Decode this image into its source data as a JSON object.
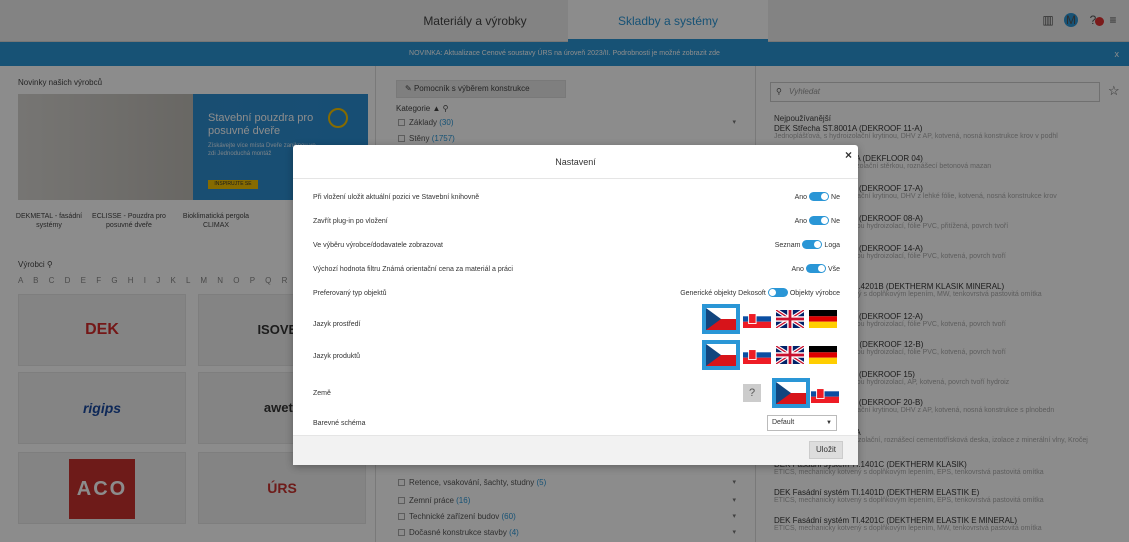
{
  "topbar": {
    "tab_materials": "Materiály a výrobky",
    "tab_compositions": "Skladby a systémy",
    "user_initial": "M"
  },
  "newsbar": {
    "text": "NOVINKA: Aktualizace Cenové soustavy ÚRS na úroveň 2023/II. Podrobnosti je možné zobrazit zde",
    "close": "x"
  },
  "left": {
    "news_title": "Novinky našich výrobců",
    "banner": {
      "title": "Stavební pouzdra pro posuvné dveře",
      "subtitle": "Získávejte více místa Dveře zaniknou ve zdi Jednoduchá montáž",
      "button": "INSPIRUJTE SE"
    },
    "captions": [
      "DEKMETAL - fasádní systémy",
      "ECLISSE - Pouzdra pro posuvné dveře",
      "Bioklimatická pergola CLIMAX"
    ],
    "manufacturers_title": "Výrobci",
    "alphabet": "A B C D E F G H I J K L M N O P Q R S T",
    "logos": [
      "DEK",
      "ISOVER",
      "rigips",
      "aweta",
      "ACO",
      "ÚRS"
    ]
  },
  "mid": {
    "helper_button": "Pomocník s výběrem konstrukce",
    "categories_title": "Kategorie ▲",
    "items": [
      {
        "label": "Základy",
        "count": "(30)"
      },
      {
        "label": "Stěny",
        "count": "(1757)"
      },
      {
        "label": "Retence, vsakování, šachty, studny",
        "count": "(5)"
      },
      {
        "label": "Zemní práce",
        "count": "(16)"
      },
      {
        "label": "Technické zařízení budov",
        "count": "(60)"
      },
      {
        "label": "Dočasné konstrukce stavby",
        "count": "(4)"
      }
    ]
  },
  "right": {
    "search_placeholder": "Vyhledat",
    "most_used": "Nejpoužívanější",
    "items": [
      {
        "title": "DEK Střecha ST.8001A (DEKROOF 11-A)",
        "desc": "Jednoplášťová, s hydroizolační krytinou, DHV z AP, kotvená, nosná konstrukce krov v podhl"
      },
      {
        "title": "DEK Podlaha PD.1001A (DEKFLOOR 04)",
        "desc": "Podlaha plovoucí, s hydroizolační stěrkou, roznášecí betonová mazan"
      },
      {
        "title": "DEK Střecha ST.2001A (DEKROOF 17-A)",
        "desc": "Jednoplášťová, s hydroizolační krytinou, DHV z lehké fólie, kotvená, nosná konstrukce krov"
      },
      {
        "title": "DEK Střecha ST.2001A (DEKROOF 08-A)",
        "desc": "Jednoplášťová, s povlakovou hydroizolací, fólie PVC, přitížená, povrch tvoří"
      },
      {
        "title": "DEK Střecha ST.2001A (DEKROOF 14-A)",
        "desc": "Jednoplášťová, s povlakovou hydroizolací, fólie PVC, kotvená, povrch tvoří"
      },
      {
        "title": "DEK Fasádní systém TI.4201B (DEKTHERM KLASIK MINERAL)",
        "desc": "ETICS, mechanicky kotvený s doplňkovým lepením, MW, tenkovrstvá pastovitá omítka"
      },
      {
        "title": "DEK Střecha ST.2001A (DEKROOF 12-A)",
        "desc": "Jednoplášťová, s povlakovou hydroizolací, fólie PVC, kotvená, povrch tvoří"
      },
      {
        "title": "DEK Střecha ST.2001B (DEKROOF 12-B)",
        "desc": "Jednoplášťová, s povlakovou hydroizolací, fólie PVC, kotvená, povrch tvoří"
      },
      {
        "title": "DEK Střecha ST.2001A (DEKROOF 15)",
        "desc": "Jednoplášťová, s povlakovou hydroizolací, AP, kotvená, povrch tvoří hydroiz"
      },
      {
        "title": "DEK Střecha ST.8001F (DEKROOF 20-B)",
        "desc": "Jednoplášťová, s hydroizolační krytinou, DHV z AP, kotvená, nosná konstrukce s plnobedn"
      },
      {
        "title": "DEK Podlaha PD.1001A",
        "desc": "Podlaha plovoucí, tepelně izolační, roznášecí cementotřísková deska, izolace z minerální vlny, Kročej"
      },
      {
        "title": "DEK Fasádní systém TI.1401C (DEKTHERM KLASIK)",
        "desc": "ETICS, mechanicky kotvený s doplňkovým lepením, EPS, tenkovrstvá pastovitá omítka"
      },
      {
        "title": "DEK Fasádní systém TI.1401D (DEKTHERM ELASTIK E)",
        "desc": "ETICS, mechanicky kotvený s doplňkovým lepením, EPS, tenkovrstvá pastovitá omítka"
      },
      {
        "title": "DEK Fasádní systém TI.4201C (DEKTHERM ELASTIK E MINERAL)",
        "desc": "ETICS, mechanicky kotvený s doplňkovým lepením, MW, tenkovrstvá pastovitá omítka"
      }
    ]
  },
  "modal": {
    "title": "Nastavení",
    "close": "×",
    "rows": [
      {
        "label": "Při vložení uložit aktuální pozici ve Stavební knihovně",
        "left": "Ano",
        "right": "Ne"
      },
      {
        "label": "Zavřít plug-in po vložení",
        "left": "Ano",
        "right": "Ne"
      },
      {
        "label": "Ve výběru výrobce/dodavatele zobrazovat",
        "left": "Seznam",
        "right": "Loga"
      },
      {
        "label": "Výchozí hodnota filtru Známá orientační cena za materiál a práci",
        "left": "Ano",
        "right": "Vše"
      },
      {
        "label": "Preferovaný typ objektů",
        "left": "Generické objekty Dekosoft",
        "right": "Objekty výrobce"
      }
    ],
    "env_lang_label": "Jazyk prostředí",
    "prod_lang_label": "Jazyk produktů",
    "country_label": "Země",
    "country_unknown": "?",
    "scheme_label": "Barevné schéma",
    "scheme_value": "Default",
    "save": "Uložit"
  }
}
